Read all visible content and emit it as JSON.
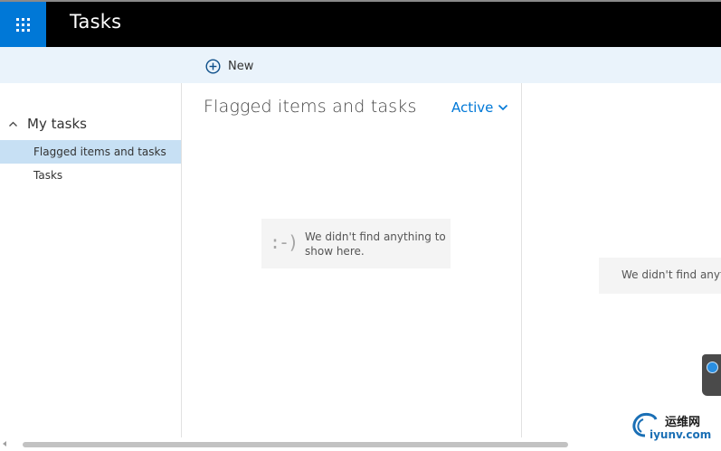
{
  "header": {
    "app_launcher_icon": "app-launcher-grid-icon",
    "app_title": "Tasks",
    "colors": {
      "bar": "#000000",
      "launcher": "#0078d7"
    }
  },
  "commandbar": {
    "new_label": "New",
    "new_icon": "add-circle-icon"
  },
  "sidebar": {
    "group_label": "My tasks",
    "group_icon": "chevron-up-icon",
    "items": [
      {
        "label": "Flagged items and tasks",
        "selected": true
      },
      {
        "label": "Tasks",
        "selected": false
      }
    ]
  },
  "list": {
    "title": "Flagged items and tasks",
    "filter_label": "Active",
    "filter_icon": "chevron-down-icon",
    "empty_face": ":-)",
    "empty_message": "We didn't find anything to show here."
  },
  "reading_pane": {
    "empty_message": "We didn't find anyth"
  },
  "watermark": {
    "text_cn": "运维网",
    "text_en": "iyunv.com"
  }
}
